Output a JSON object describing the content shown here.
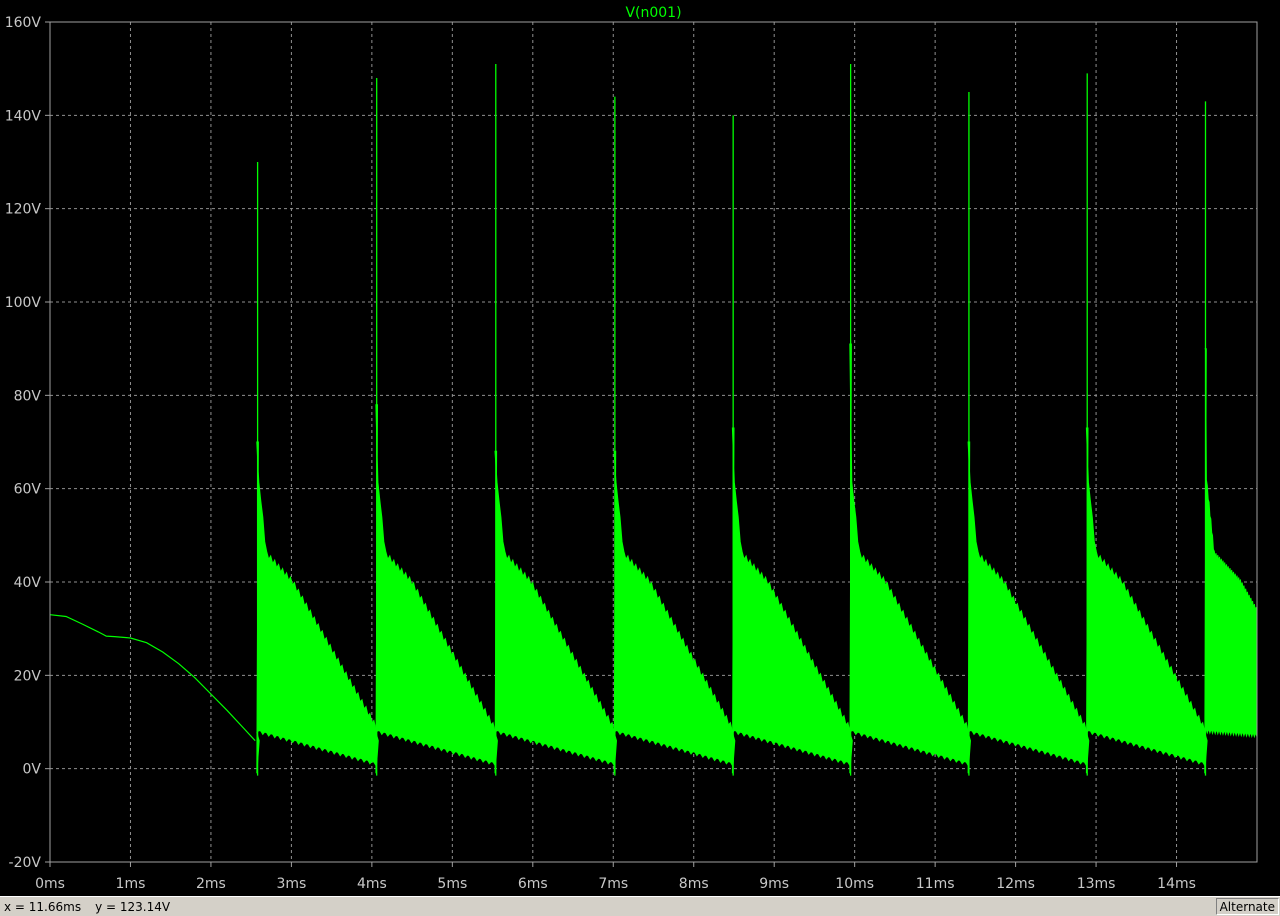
{
  "colors": {
    "background": "#000000",
    "grid": "#909090",
    "axis_text": "#c8c8c8",
    "trace": "#00ff00"
  },
  "chart_data": {
    "type": "line",
    "title": "V(n001)",
    "xlabel": "",
    "ylabel": "",
    "xlim": [
      0,
      15
    ],
    "ylim": [
      -20,
      160
    ],
    "x_ticks": [
      "0ms",
      "1ms",
      "2ms",
      "3ms",
      "4ms",
      "5ms",
      "6ms",
      "7ms",
      "8ms",
      "9ms",
      "10ms",
      "11ms",
      "12ms",
      "13ms",
      "14ms"
    ],
    "y_ticks": [
      "-20V",
      "0V",
      "20V",
      "40V",
      "60V",
      "80V",
      "100V",
      "120V",
      "140V",
      "160V"
    ],
    "grid": true,
    "x_unit": "ms",
    "y_unit": "V",
    "series": [
      {
        "name": "V(n001)",
        "color": "#00ff00",
        "startup_curve": {
          "x": [
            0.0,
            0.2,
            0.4,
            0.6,
            0.7,
            0.8,
            1.0,
            1.2,
            1.4,
            1.6,
            1.8,
            2.0,
            2.2,
            2.4,
            2.55
          ],
          "y": [
            33,
            32.6,
            31.0,
            29.3,
            28.4,
            28.3,
            28.0,
            27.0,
            25.0,
            22.5,
            19.5,
            16.0,
            12.5,
            8.8,
            6.0
          ]
        },
        "pulses": [
          {
            "start": 2.57,
            "end": 4.05,
            "peak": 130,
            "secondary_peak": 70,
            "upper_start": 63,
            "upper_knee": 46,
            "upper_end": 9,
            "lower_start": 8,
            "lower_end": 1
          },
          {
            "start": 4.05,
            "end": 5.53,
            "peak": 148,
            "secondary_peak": 78,
            "upper_start": 63,
            "upper_knee": 46,
            "upper_end": 8.5,
            "lower_start": 8,
            "lower_end": 1
          },
          {
            "start": 5.53,
            "end": 7.01,
            "peak": 151,
            "secondary_peak": 68,
            "upper_start": 63,
            "upper_knee": 46,
            "upper_end": 8.5,
            "lower_start": 8,
            "lower_end": 1
          },
          {
            "start": 7.01,
            "end": 8.48,
            "peak": 144,
            "secondary_peak": 68,
            "upper_start": 63,
            "upper_knee": 46,
            "upper_end": 8.5,
            "lower_start": 8,
            "lower_end": 1
          },
          {
            "start": 8.48,
            "end": 9.94,
            "peak": 140,
            "secondary_peak": 73,
            "upper_start": 63,
            "upper_knee": 46,
            "upper_end": 8.5,
            "lower_start": 8,
            "lower_end": 1
          },
          {
            "start": 9.94,
            "end": 11.41,
            "peak": 151,
            "secondary_peak": 91,
            "upper_start": 63,
            "upper_knee": 46,
            "upper_end": 8.5,
            "lower_start": 8,
            "lower_end": 1
          },
          {
            "start": 11.41,
            "end": 12.88,
            "peak": 145,
            "secondary_peak": 70,
            "upper_start": 63,
            "upper_knee": 46,
            "upper_end": 8.5,
            "lower_start": 8,
            "lower_end": 1
          },
          {
            "start": 12.88,
            "end": 14.35,
            "peak": 149,
            "secondary_peak": 73,
            "upper_start": 63,
            "upper_knee": 46,
            "upper_end": 8.5,
            "lower_start": 8,
            "lower_end": 1
          },
          {
            "start": 14.35,
            "end": 15.0,
            "peak": 143,
            "secondary_peak": 90,
            "upper_start": 63,
            "upper_knee": 46,
            "upper_end": 34,
            "lower_start": 8,
            "lower_end": 6
          }
        ]
      }
    ]
  },
  "status": {
    "x_readout": "x = 11.66ms",
    "y_readout": "y = 123.14V",
    "mode": "Alternate"
  }
}
